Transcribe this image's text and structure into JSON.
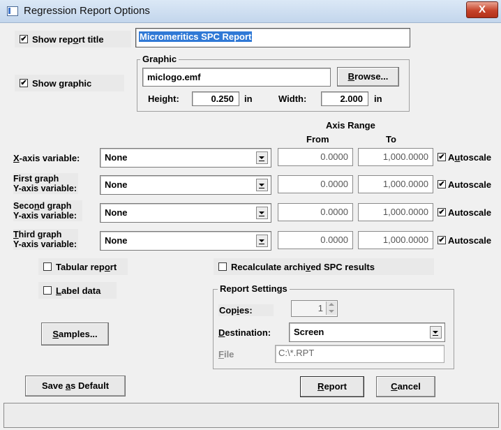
{
  "window": {
    "title": "Regression Report Options",
    "close_glyph": "X"
  },
  "report_title": {
    "checkbox_label_pre": "Show rep",
    "checkbox_label_u": "o",
    "checkbox_label_post": "rt title",
    "checked": "✔",
    "value": "Micromeritics SPC Report"
  },
  "graphic": {
    "checkbox_label_pre": "Show ",
    "checkbox_label_u": "g",
    "checkbox_label_post": "raphic",
    "checked": "✔",
    "group_title": "Graphic",
    "file_value": "miclogo.emf",
    "browse_pre": "",
    "browse_u": "B",
    "browse_post": "rowse...",
    "height_label": "Height:",
    "height_value": "0.250",
    "height_unit": "in",
    "width_label": "Width:",
    "width_value": "2.000",
    "width_unit": "in"
  },
  "axis_header": {
    "title": "Axis Range",
    "from": "From",
    "to": "To"
  },
  "axes": [
    {
      "label_u": "X",
      "label_rest": "-axis variable:",
      "line2": "",
      "value": "None",
      "from": "0.0000",
      "to": "1,000.0000",
      "autoscale_pre": "A",
      "autoscale_u": "u",
      "autoscale_post": "toscale"
    },
    {
      "label_u": "",
      "label_rest": "First graph",
      "line2": "Y-axis variable:",
      "value": "None",
      "from": "0.0000",
      "to": "1,000.0000",
      "autoscale_pre": "Autoscale",
      "autoscale_u": "",
      "autoscale_post": ""
    },
    {
      "label_u": "",
      "label_rest": "Seco",
      "label_u2": "n",
      "label_rest2": "d graph",
      "line2": "Y-axis variable:",
      "value": "None",
      "from": "0.0000",
      "to": "1,000.0000",
      "autoscale_pre": "Autoscale",
      "autoscale_u": "",
      "autoscale_post": ""
    },
    {
      "label_u": "T",
      "label_rest": "hird graph",
      "line2": "Y-axis variable:",
      "value": "None",
      "from": "0.0000",
      "to": "1,000.0000",
      "autoscale_pre": "Autoscale",
      "autoscale_u": "",
      "autoscale_post": ""
    }
  ],
  "checked_glyph": "✔",
  "options": {
    "tabular_pre": "Tabular rep",
    "tabular_u": "o",
    "tabular_post": "rt",
    "label_u": "L",
    "label_post": "abel data",
    "recalc_pre": "Recalculate archi",
    "recalc_u": "v",
    "recalc_post": "ed SPC results"
  },
  "samples_button": {
    "u": "S",
    "post": "amples..."
  },
  "report_settings": {
    "group_title": "Report Settings",
    "copies_pre": "Cop",
    "copies_u": "i",
    "copies_post": "es:",
    "copies_value": "1",
    "dest_u": "D",
    "dest_post": "estination:",
    "dest_value": "Screen",
    "file_u": "F",
    "file_post": "ile",
    "file_value": "C:\\*.RPT"
  },
  "buttons": {
    "save_pre": "Save ",
    "save_u": "a",
    "save_post": "s Default",
    "report_u": "R",
    "report_post": "eport",
    "cancel_u": "C",
    "cancel_post": "ancel"
  }
}
